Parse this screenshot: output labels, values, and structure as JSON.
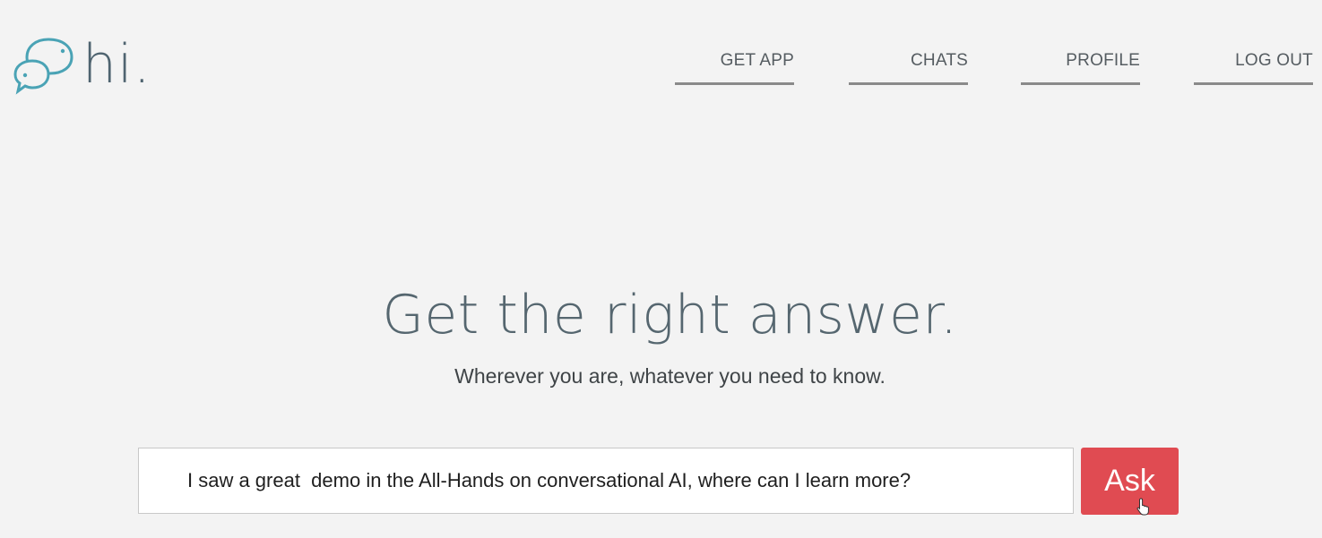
{
  "brand": {
    "logo_text": "hi.",
    "logo_icon": "chat-bubbles-icon",
    "logo_color": "#4aa3b5"
  },
  "nav": {
    "items": [
      {
        "label": "GET APP"
      },
      {
        "label": "CHATS"
      },
      {
        "label": "PROFILE"
      },
      {
        "label": "LOG OUT"
      }
    ]
  },
  "hero": {
    "title": "Get the right answer.",
    "subtitle": "Wherever you are, whatever you need to know."
  },
  "search": {
    "value": "I saw a great  demo in the All-Hands on conversational AI, where can I learn more?",
    "button_label": "Ask",
    "button_color": "#e04b52"
  },
  "cursor": {
    "icon": "hand-pointer-icon"
  }
}
